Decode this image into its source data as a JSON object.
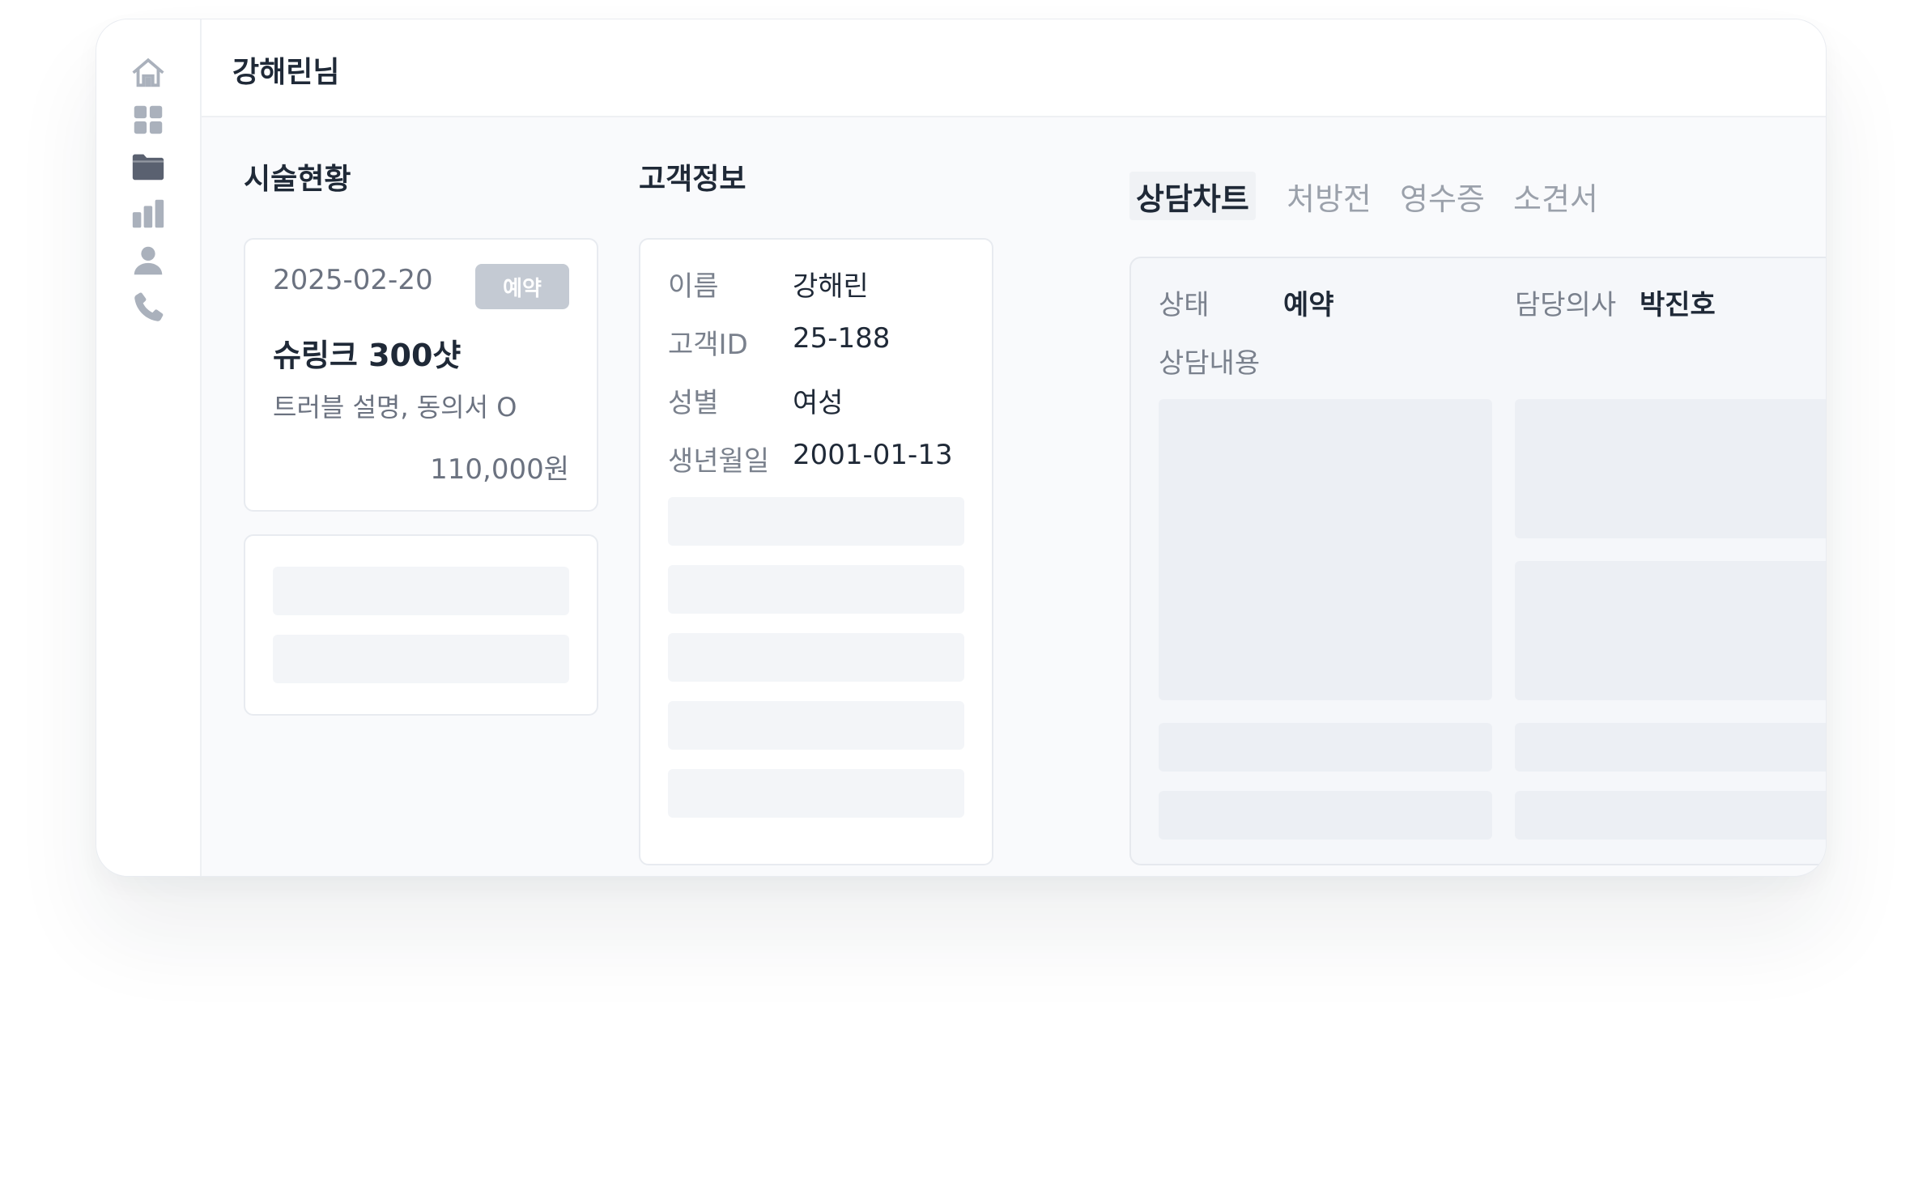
{
  "header": {
    "user_title": "강해린님"
  },
  "sidebar": {
    "icons": [
      "home-icon",
      "grid-icon",
      "folder-icon",
      "bar-chart-icon",
      "person-icon",
      "phone-icon"
    ],
    "active": "folder-icon"
  },
  "treatment": {
    "title": "시술현황",
    "card": {
      "date": "2025-02-20",
      "status": "예약",
      "name": "슈링크 300샷",
      "description": "트러블 설명, 동의서 O",
      "price": "110,000원"
    }
  },
  "customer": {
    "title": "고객정보",
    "fields": [
      {
        "label": "이름",
        "value": "강해린"
      },
      {
        "label": "고객ID",
        "value": "25-188"
      },
      {
        "label": "성별",
        "value": "여성"
      },
      {
        "label": "생년월일",
        "value": "2001-01-13"
      }
    ]
  },
  "chart": {
    "tabs": [
      "상담차트",
      "처방전",
      "영수증",
      "소견서"
    ],
    "active_tab": "상담차트",
    "status_label": "상태",
    "status_value": "예약",
    "doctor_label": "담당의사",
    "doctor_value": "박진호",
    "content_label": "상담내용"
  },
  "colors": {
    "background": "#f9fafc",
    "card": "#ffffff",
    "badge": "#c4cad3",
    "text_primary": "#1f2937",
    "text_secondary": "#6b7280",
    "placeholder": "#f3f5f8"
  }
}
